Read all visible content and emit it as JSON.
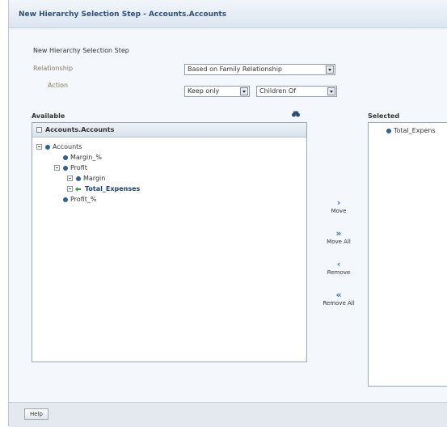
{
  "title": "New Hierarchy Selection Step - Accounts.Accounts",
  "step_label": "New Hierarchy Selection Step",
  "relationship": {
    "label": "Relationship",
    "value": "Based on Family Relationship"
  },
  "action": {
    "label": "Action",
    "value": "Keep only",
    "target": "Children Of"
  },
  "available": {
    "label": "Available",
    "panel_title": "Accounts.Accounts",
    "tree": [
      {
        "label": "Accounts",
        "level": 0,
        "toggle": true,
        "type": "member"
      },
      {
        "label": "Margin_%",
        "level": 1,
        "toggle": false,
        "type": "member"
      },
      {
        "label": "Profit",
        "level": 1,
        "toggle": true,
        "type": "member"
      },
      {
        "label": "Margin",
        "level": 2,
        "toggle": true,
        "type": "member"
      },
      {
        "label": "Total_Expenses",
        "level": 2,
        "toggle": true,
        "type": "selected"
      },
      {
        "label": "Profit_%",
        "level": 1,
        "toggle": false,
        "type": "member"
      }
    ]
  },
  "buttons": {
    "move": "Move",
    "move_all": "Move All",
    "remove": "Remove",
    "remove_all": "Remove All"
  },
  "selected": {
    "label": "Selected",
    "items": [
      "Total_Expens"
    ]
  },
  "footer": {
    "help": "Help"
  }
}
